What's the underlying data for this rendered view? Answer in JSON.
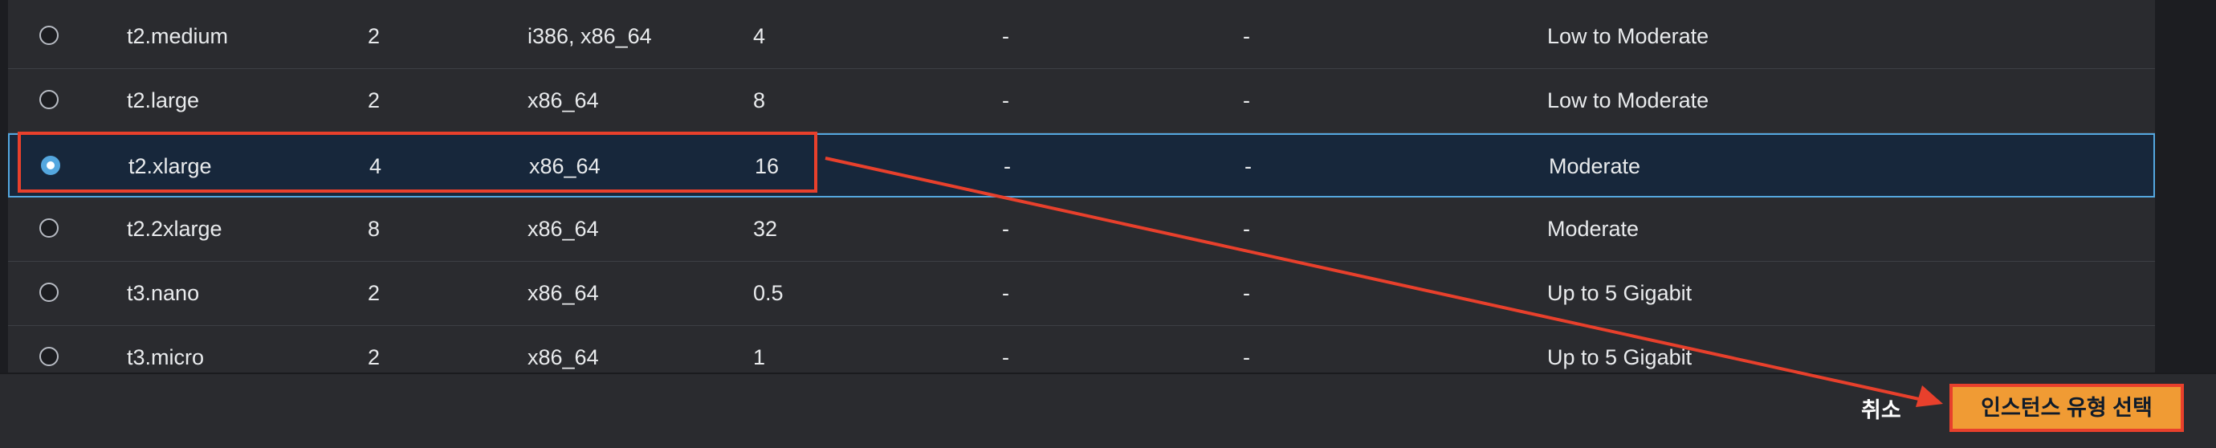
{
  "table": {
    "rows": [
      {
        "name": "t2.medium",
        "vcpu": "2",
        "arch": "i386, x86_64",
        "memory": "4",
        "col5": "-",
        "col6": "-",
        "network": "Low to Moderate",
        "selected": false
      },
      {
        "name": "t2.large",
        "vcpu": "2",
        "arch": "x86_64",
        "memory": "8",
        "col5": "-",
        "col6": "-",
        "network": "Low to Moderate",
        "selected": false
      },
      {
        "name": "t2.xlarge",
        "vcpu": "4",
        "arch": "x86_64",
        "memory": "16",
        "col5": "-",
        "col6": "-",
        "network": "Moderate",
        "selected": true
      },
      {
        "name": "t2.2xlarge",
        "vcpu": "8",
        "arch": "x86_64",
        "memory": "32",
        "col5": "-",
        "col6": "-",
        "network": "Moderate",
        "selected": false
      },
      {
        "name": "t3.nano",
        "vcpu": "2",
        "arch": "x86_64",
        "memory": "0.5",
        "col5": "-",
        "col6": "-",
        "network": "Up to 5 Gigabit",
        "selected": false
      },
      {
        "name": "t3.micro",
        "vcpu": "2",
        "arch": "x86_64",
        "memory": "1",
        "col5": "-",
        "col6": "-",
        "network": "Up to 5 Gigabit",
        "selected": false
      }
    ]
  },
  "footer": {
    "cancel_label": "취소",
    "select_label": "인스턴스 유형 선택"
  },
  "colors": {
    "selected_row_bg": "#17273b",
    "selected_border": "#54a7df",
    "primary_button": "#f09b34",
    "annotation_red": "#e8402c"
  }
}
